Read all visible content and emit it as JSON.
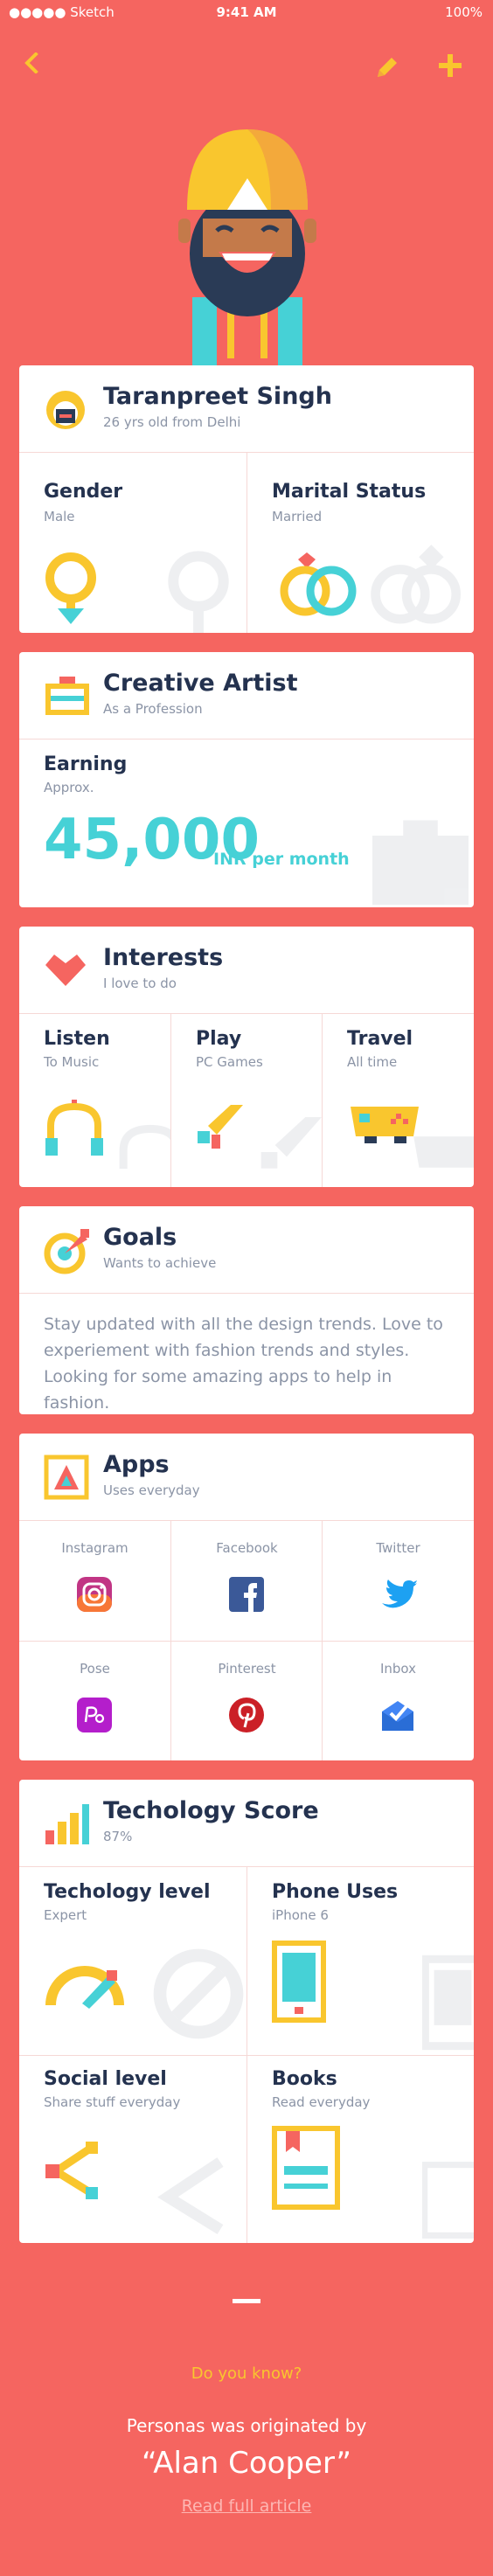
{
  "status_bar": {
    "signal": "●●●●● Sketch",
    "time": "9:41 AM",
    "battery": "100%"
  },
  "header": {
    "back_icon": "chevron-left-icon",
    "edit_icon": "pencil-icon",
    "add_icon": "plus-icon"
  },
  "colors": {
    "background": "#F56560",
    "accent_yellow": "#F9C62E",
    "accent_teal": "#46D1D6",
    "text_dark": "#24324F",
    "muted": "#8B94A6"
  },
  "profile": {
    "name": "Taranpreet Singh",
    "subtitle": "26 yrs old from Delhi",
    "gender_label": "Gender",
    "gender_value": "Male",
    "marital_label": "Marital Status",
    "marital_value": "Married"
  },
  "profession": {
    "title": "Creative Artist",
    "subtitle": "As a Profession",
    "earning_label": "Earning",
    "earning_sub": "Approx.",
    "amount": "45,000",
    "unit": "INR per month"
  },
  "interests": {
    "title": "Interests",
    "subtitle": "I love to do",
    "items": [
      {
        "label": "Listen",
        "sub": "To Music",
        "icon": "headphones-icon"
      },
      {
        "label": "Play",
        "sub": "PC Games",
        "icon": "gun-icon"
      },
      {
        "label": "Travel",
        "sub": "All time",
        "icon": "car-icon"
      }
    ]
  },
  "goals": {
    "title": "Goals",
    "subtitle": "Wants to achieve",
    "body": "Stay updated with all the design trends. Love to experiement with fashion trends and styles. Looking for some amazing apps to help in fashion."
  },
  "apps": {
    "title": "Apps",
    "subtitle": "Uses everyday",
    "items": [
      {
        "name": "Instagram",
        "icon": "instagram-icon"
      },
      {
        "name": "Facebook",
        "icon": "facebook-icon"
      },
      {
        "name": "Twitter",
        "icon": "twitter-icon"
      },
      {
        "name": "Pose",
        "icon": "pose-icon"
      },
      {
        "name": "Pinterest",
        "icon": "pinterest-icon"
      },
      {
        "name": "Inbox",
        "icon": "inbox-icon"
      }
    ]
  },
  "tech": {
    "title": "Techology Score",
    "subtitle": "87%",
    "items": [
      {
        "label": "Techology level",
        "sub": "Expert",
        "icon": "gauge-icon"
      },
      {
        "label": "Phone Uses",
        "sub": "iPhone 6",
        "icon": "phone-icon"
      },
      {
        "label": "Social level",
        "sub": "Share stuff everyday",
        "icon": "share-icon"
      },
      {
        "label": "Books",
        "sub": "Read everyday",
        "icon": "book-icon"
      }
    ]
  },
  "footer": {
    "did_you_know": "Do you know?",
    "line": "Personas was originated by",
    "quote": "“Alan Cooper”",
    "link": "Read full article"
  }
}
